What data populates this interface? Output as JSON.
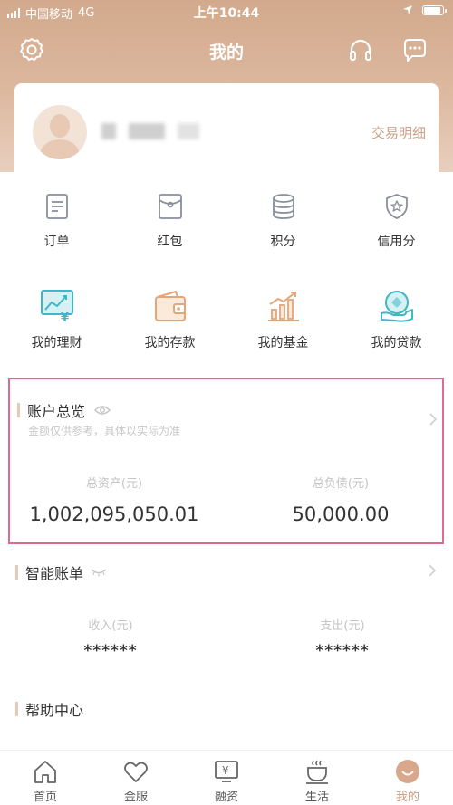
{
  "status_bar": {
    "carrier": "中国移动",
    "network": "4G",
    "time": "上午10:44"
  },
  "header": {
    "title": "我的",
    "left_icon": "gear-icon",
    "right_icons": [
      "headset-icon",
      "chat-bubble-icon"
    ]
  },
  "profile": {
    "trade_detail_label": "交易明细"
  },
  "services": [
    {
      "label": "订单",
      "icon": "document-icon"
    },
    {
      "label": "红包",
      "icon": "red-envelope-icon"
    },
    {
      "label": "积分",
      "icon": "points-stack-icon"
    },
    {
      "label": "信用分",
      "icon": "shield-star-icon"
    }
  ],
  "products": [
    {
      "label": "我的理财",
      "icon": "wealth-chart-icon"
    },
    {
      "label": "我的存款",
      "icon": "wallet-icon"
    },
    {
      "label": "我的基金",
      "icon": "fund-growth-icon"
    },
    {
      "label": "我的贷款",
      "icon": "loan-hand-icon"
    }
  ],
  "account_overview": {
    "title": "账户总览",
    "subtitle": "金额仅供参考，具体以实际为准",
    "assets_caption": "总资产(元)",
    "assets_value": "1,002,095,050.01",
    "liabilities_caption": "总负债(元)",
    "liabilities_value": "50,000.00"
  },
  "smart_bill": {
    "title": "智能账单",
    "income_caption": "收入(元)",
    "income_value": "******",
    "expense_caption": "支出(元)",
    "expense_value": "******"
  },
  "help_center": {
    "title": "帮助中心"
  },
  "tabbar": [
    {
      "label": "首页",
      "icon": "home-icon"
    },
    {
      "label": "金服",
      "icon": "heart-icon"
    },
    {
      "label": "融资",
      "icon": "yuan-screen-icon"
    },
    {
      "label": "生活",
      "icon": "coffee-cup-icon"
    },
    {
      "label": "我的",
      "icon": "profile-face-icon"
    }
  ],
  "colors": {
    "header_gradient_start": "#d2a98c",
    "accent_gold": "#c8a28a",
    "teal": "#3fb7c4",
    "highlight_border": "#e06a8c"
  }
}
